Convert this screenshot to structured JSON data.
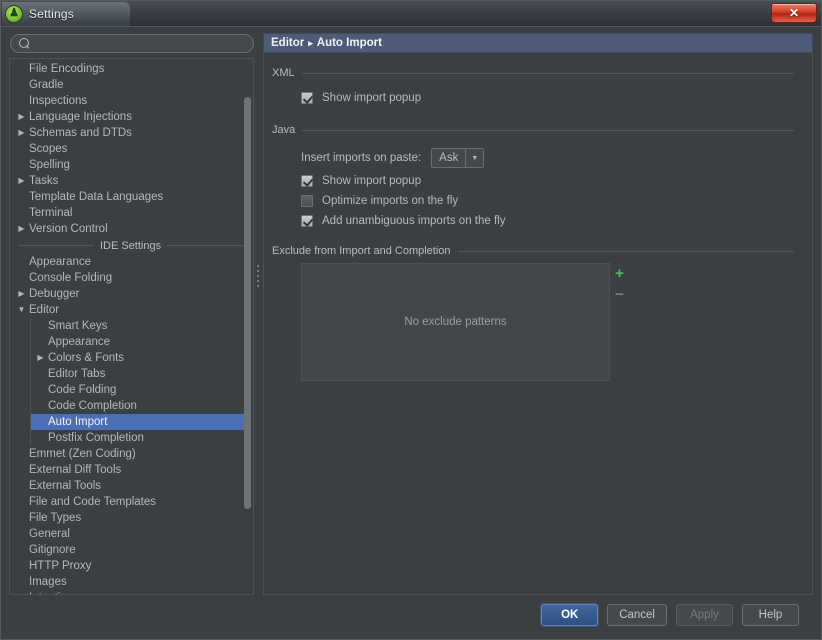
{
  "window": {
    "title": "Settings",
    "app_icon": "android-studio-icon",
    "close_label": "✕"
  },
  "search": {
    "placeholder": "",
    "value": "",
    "icon": "search-icon"
  },
  "sidebar": {
    "project_items": [
      {
        "label": "File Encodings",
        "expandable": false
      },
      {
        "label": "Gradle",
        "expandable": false
      },
      {
        "label": "Inspections",
        "expandable": false
      },
      {
        "label": "Language Injections",
        "expandable": true
      },
      {
        "label": "Schemas and DTDs",
        "expandable": true
      },
      {
        "label": "Scopes",
        "expandable": false
      },
      {
        "label": "Spelling",
        "expandable": false
      },
      {
        "label": "Tasks",
        "expandable": true
      },
      {
        "label": "Template Data Languages",
        "expandable": false
      },
      {
        "label": "Terminal",
        "expandable": false
      },
      {
        "label": "Version Control",
        "expandable": true
      }
    ],
    "separator_label": "IDE Settings",
    "ide_items_top": [
      {
        "label": "Appearance",
        "expandable": false
      },
      {
        "label": "Console Folding",
        "expandable": false
      },
      {
        "label": "Debugger",
        "expandable": true
      }
    ],
    "editor_node": {
      "label": "Editor",
      "expanded": true,
      "marker": "▼"
    },
    "editor_children": [
      {
        "label": "Smart Keys",
        "expandable": false,
        "selected": false
      },
      {
        "label": "Appearance",
        "expandable": false,
        "selected": false
      },
      {
        "label": "Colors & Fonts",
        "expandable": true,
        "selected": false
      },
      {
        "label": "Editor Tabs",
        "expandable": false,
        "selected": false
      },
      {
        "label": "Code Folding",
        "expandable": false,
        "selected": false
      },
      {
        "label": "Code Completion",
        "expandable": false,
        "selected": false
      },
      {
        "label": "Auto Import",
        "expandable": false,
        "selected": true
      },
      {
        "label": "Postfix Completion",
        "expandable": false,
        "selected": false
      }
    ],
    "ide_items_bottom": [
      {
        "label": "Emmet (Zen Coding)",
        "expandable": false
      },
      {
        "label": "External Diff Tools",
        "expandable": false
      },
      {
        "label": "External Tools",
        "expandable": false
      },
      {
        "label": "File and Code Templates",
        "expandable": false
      },
      {
        "label": "File Types",
        "expandable": false
      },
      {
        "label": "General",
        "expandable": false
      },
      {
        "label": "Gitignore",
        "expandable": false
      },
      {
        "label": "HTTP Proxy",
        "expandable": false
      },
      {
        "label": "Images",
        "expandable": false
      },
      {
        "label": "Intentions",
        "expandable": false
      }
    ],
    "expand_marker": "▶"
  },
  "panel": {
    "breadcrumb_root": "Editor",
    "breadcrumb_separator": "▸",
    "breadcrumb_leaf": "Auto Import",
    "xml": {
      "group_title": "XML",
      "show_import_popup": {
        "label": "Show import popup",
        "checked": true
      }
    },
    "java": {
      "group_title": "Java",
      "insert_imports": {
        "label": "Insert imports on paste:",
        "value": "Ask",
        "arrow": "▼"
      },
      "show_import_popup": {
        "label": "Show import popup",
        "checked": true
      },
      "optimize_imports": {
        "label": "Optimize imports on the fly",
        "checked": false
      },
      "add_unambiguous": {
        "label": "Add unambiguous imports on the fly",
        "checked": true
      }
    },
    "exclude": {
      "group_title": "Exclude from Import and Completion",
      "empty_text": "No exclude patterns",
      "add_label": "+",
      "remove_label": "−",
      "add_color": "#4fbf62",
      "remove_color": "#7d8183"
    }
  },
  "footer": {
    "ok": "OK",
    "cancel": "Cancel",
    "apply": "Apply",
    "help": "Help",
    "apply_enabled": false
  },
  "colors": {
    "window_bg": "#3c3f41",
    "header_blue": "#4d5b77",
    "selection_blue": "#4a6fb5",
    "primary_button": "#2f4f80",
    "text": "#b7bbbe"
  }
}
